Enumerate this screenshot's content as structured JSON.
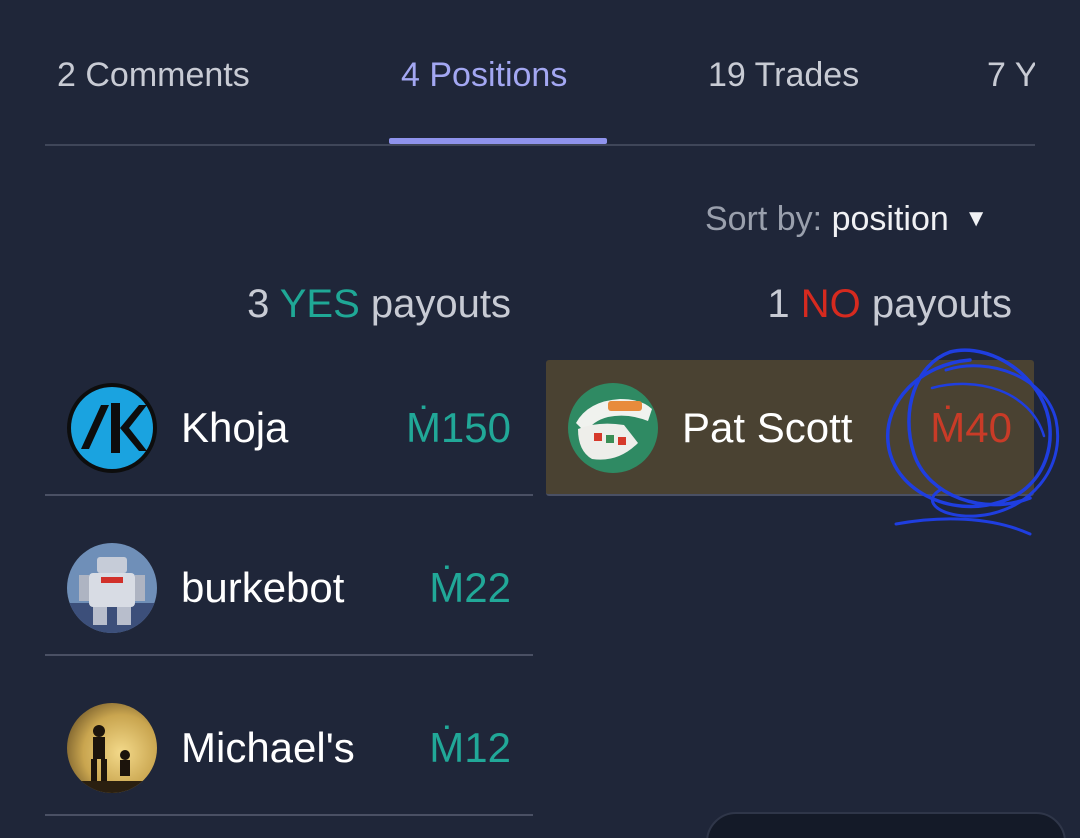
{
  "tabs": [
    {
      "label": "2 Comments",
      "active": false
    },
    {
      "label": "4 Positions",
      "active": true
    },
    {
      "label": "19 Trades",
      "active": false
    },
    {
      "label": "7 Y",
      "active": false
    }
  ],
  "sort": {
    "label": "Sort by:",
    "value": "position",
    "caret": "▼"
  },
  "yes_header": {
    "count": "3",
    "word": "YES",
    "suffix": "payouts"
  },
  "no_header": {
    "count": "1",
    "word": "NO",
    "suffix": "payouts"
  },
  "yes_positions": [
    {
      "name": "Khoja",
      "amount": "Ṁ150"
    },
    {
      "name": "burkebot",
      "amount": "Ṁ22"
    },
    {
      "name": "Michael's",
      "amount": "Ṁ12"
    }
  ],
  "no_positions": [
    {
      "name": "Pat Scott",
      "amount": "Ṁ40"
    }
  ],
  "colors": {
    "background": "#1f2639",
    "yes": "#1fa896",
    "no": "#d62a1f",
    "active_tab": "#a3a7f2",
    "scribble": "#1f3ee0"
  }
}
